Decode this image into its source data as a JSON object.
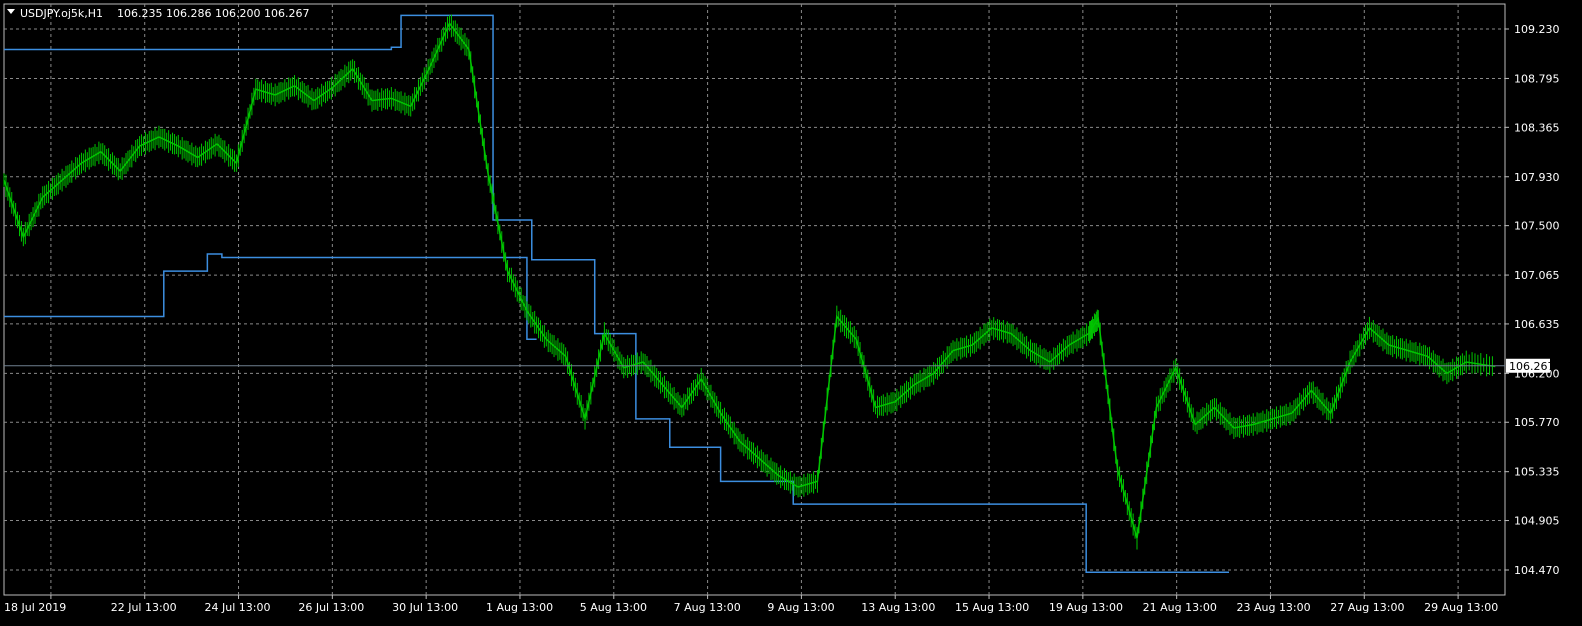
{
  "header": {
    "symbol_label": "USDJPY.oj5k,H1",
    "ohlc_text": "106.235 106.286 106.200 106.267"
  },
  "colors": {
    "background": "#000000",
    "grid": "#8a8a8a",
    "price_line": "#00c400",
    "level_line": "#3c8ee0",
    "text": "#ffffff",
    "current_price_line": "#708090"
  },
  "chart_data": {
    "type": "line",
    "price_axis": {
      "ticks": [
        "109.230",
        "108.795",
        "108.365",
        "107.930",
        "107.500",
        "107.065",
        "106.635",
        "106.200",
        "105.770",
        "105.335",
        "104.905",
        "104.470"
      ],
      "min": 104.25,
      "max": 109.45
    },
    "time_axis": {
      "labels": [
        "18 Jul 2019",
        "22 Jul 13:00",
        "24 Jul 13:00",
        "26 Jul 13:00",
        "30 Jul 13:00",
        "1 Aug 13:00",
        "5 Aug 13:00",
        "7 Aug 13:00",
        "9 Aug 13:00",
        "13 Aug 13:00",
        "15 Aug 13:00",
        "19 Aug 13:00",
        "21 Aug 13:00",
        "23 Aug 13:00",
        "27 Aug 13:00",
        "29 Aug 13:00"
      ]
    },
    "current_price": {
      "value": 106.267,
      "label": "106.267"
    },
    "series": [
      {
        "role": "price",
        "x": [
          0,
          0.4,
          0.8,
          1.2,
          1.6,
          2,
          2.4,
          2.8,
          3.2,
          3.6,
          4,
          4.4,
          4.8,
          5.2,
          5.6,
          6,
          6.4,
          6.8,
          7.2,
          7.6,
          8,
          8.4,
          8.8,
          9.2,
          9.6,
          10,
          10.4,
          10.8,
          11.2,
          11.6,
          12,
          12.4,
          12.8,
          13.2,
          13.6,
          14,
          14.4,
          14.8,
          15.2
        ],
        "y": [
          107.9,
          107.4,
          107.75,
          107.9,
          108.05,
          108.15,
          107.98,
          108.2,
          108.28,
          108.2,
          108.1,
          108.22,
          108.05,
          108.7,
          108.65,
          108.73,
          108.6,
          108.72,
          108.88,
          108.6,
          108.62,
          108.55,
          108.9,
          109.28,
          109.05,
          107.95,
          107.1,
          106.75,
          106.5,
          106.35,
          105.8,
          106.55,
          106.25,
          106.3,
          106.1,
          105.9,
          106.15,
          105.85,
          105.6
        ],
        "x2": [
          15.6,
          16,
          16.4,
          16.8,
          17.2,
          17.6,
          18,
          18.4,
          18.8,
          19.2,
          19.6,
          20,
          20.4,
          20.8,
          21.2,
          21.6,
          22,
          22.4,
          22.6,
          23,
          23.4,
          23.8,
          24.2,
          24.6,
          25,
          25.4,
          25.8,
          26.2,
          26.6,
          27,
          27.4,
          27.8,
          28.2,
          28.6,
          29,
          29.4,
          29.8,
          30.2,
          30.8
        ],
        "y2": [
          105.45,
          105.3,
          105.2,
          105.25,
          106.7,
          106.5,
          105.9,
          105.95,
          106.1,
          106.2,
          106.4,
          106.45,
          106.6,
          106.55,
          106.4,
          106.3,
          106.45,
          106.55,
          106.68,
          105.35,
          104.75,
          105.9,
          106.25,
          105.75,
          105.9,
          105.72,
          105.75,
          105.8,
          105.85,
          106.05,
          105.85,
          106.3,
          106.6,
          106.45,
          106.4,
          106.35,
          106.2,
          106.3,
          106.26
        ]
      },
      {
        "role": "level",
        "x": [
          0,
          8.0,
          8.0,
          8.2,
          8.2,
          8.8,
          8.8,
          10.1,
          10.1,
          10.9,
          10.9,
          11.7,
          11.7,
          12.2,
          12.2,
          13.05,
          13.05,
          13.75,
          13.75,
          14.8,
          14.8,
          16.3,
          16.3,
          22.35,
          22.35,
          23.25,
          23.25,
          25.3
        ],
        "y": [
          109.05,
          109.05,
          109.07,
          109.07,
          109.35,
          109.35,
          109.35,
          109.35,
          107.55,
          107.55,
          107.2,
          107.2,
          107.2,
          107.2,
          106.55,
          106.55,
          105.8,
          105.8,
          105.55,
          105.55,
          105.25,
          105.25,
          105.05,
          105.05,
          104.45,
          104.45,
          104.45,
          104.45
        ],
        "x_alt": [
          0,
          3.3,
          3.3,
          4.2,
          4.2,
          4.5,
          4.5,
          10.8,
          10.8,
          11.0
        ],
        "y_alt": [
          106.7,
          106.7,
          107.1,
          107.1,
          107.25,
          107.25,
          107.22,
          107.22,
          106.5,
          106.5
        ]
      }
    ]
  }
}
